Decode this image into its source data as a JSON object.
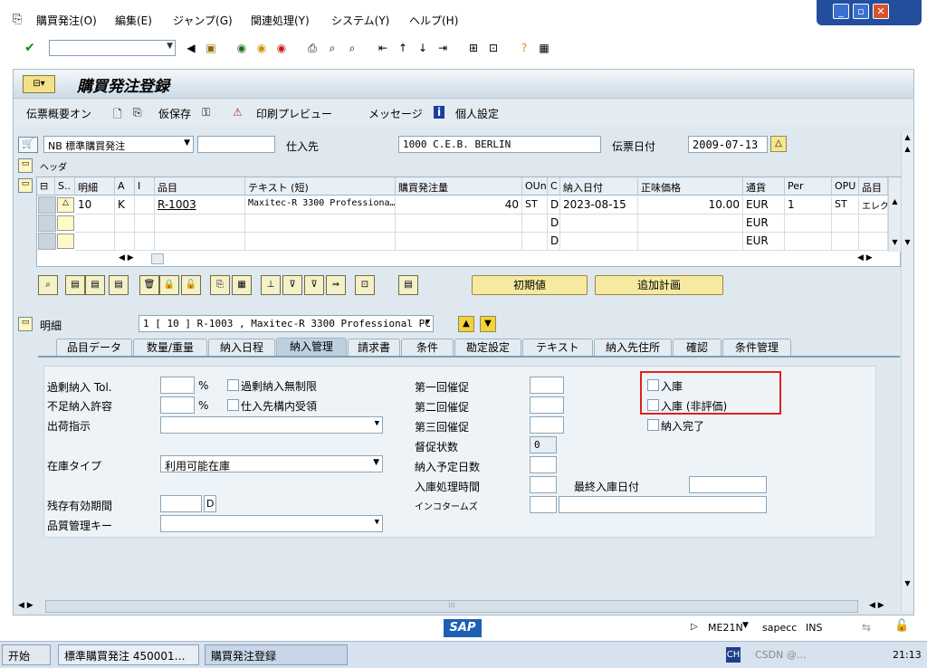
{
  "menu": {
    "items": [
      "購買発注(O)",
      "編集(E)",
      "ジャンプ(G)",
      "関連処理(Y)",
      "システム(Y)",
      "ヘルプ(H)"
    ]
  },
  "title": "購買発注登録",
  "app_toolbar": {
    "doc_overview": "伝票概要オン",
    "hold": "仮保存",
    "print_preview": "印刷プレビュー",
    "messages": "メッセージ",
    "personal": "個人設定"
  },
  "header": {
    "order_type_code": "NB",
    "order_type": "標準購買発注",
    "vendor_label": "仕入先",
    "vendor_value": "1000 C.E.B. BERLIN",
    "doc_date_label": "伝票日付",
    "doc_date": "2009-07-13",
    "header_label": "ヘッダ"
  },
  "grid": {
    "columns": [
      "S..",
      "明細",
      "A",
      "I",
      "品目",
      "テキスト (短)",
      "購買発注量",
      "OUn",
      "C",
      "納入日付",
      "正味価格",
      "通貨",
      "Per",
      "OPU",
      "品目"
    ],
    "rows": [
      {
        "item": "10",
        "a": "K",
        "material": "R-1003",
        "text": "Maxitec-R 3300 Professiona…",
        "qty": "40",
        "oun": "ST",
        "c": "D",
        "date": "2023-08-15",
        "price": "10.00",
        "curr": "EUR",
        "per": "1",
        "opu": "ST",
        "grp": "エレク"
      },
      {
        "item": "",
        "a": "",
        "material": "",
        "text": "",
        "qty": "",
        "oun": "",
        "c": "D",
        "date": "",
        "price": "",
        "curr": "EUR",
        "per": "",
        "opu": "",
        "grp": ""
      },
      {
        "item": "",
        "a": "",
        "material": "",
        "text": "",
        "qty": "",
        "oun": "",
        "c": "D",
        "date": "",
        "price": "",
        "curr": "EUR",
        "per": "",
        "opu": "",
        "grp": ""
      }
    ]
  },
  "buttons": {
    "default": "初期値",
    "add_plan": "追加計画"
  },
  "detail": {
    "label": "明細",
    "selected": "1 [ 10 ] R-1003 , Maxitec-R 3300 Professional PC"
  },
  "tabs": [
    "品目データ",
    "数量/重量",
    "納入日程",
    "納入管理",
    "請求書",
    "条件",
    "勘定設定",
    "テキスト",
    "納入先住所",
    "確認",
    "条件管理"
  ],
  "active_tab": "納入管理",
  "form": {
    "overdel_tol": "過剰納入 Tol.",
    "pct": "%",
    "unlimited_over": "過剰納入無制限",
    "underdel": "不足納入許容",
    "partial": "仕入先構内受領",
    "shipping": "出荷指示",
    "stock_type": "在庫タイプ",
    "stock_type_value": "利用可能在庫",
    "remaining_shelf": "残存有効期間",
    "shelf_unit": "D",
    "qm_key": "品質管理キー",
    "rem1": "第一回催促",
    "rem2": "第二回催促",
    "rem3": "第三回催促",
    "reminder_status": "督促状数",
    "reminder_status_value": "0",
    "plan_days": "納入予定日数",
    "gr_time": "入庫処理時間",
    "last_gr_date": "最終入庫日付",
    "incoterms": "インコタームズ",
    "gr": "入庫",
    "gr_nonval": "入庫 (非評価)",
    "delivery_complete": "納入完了"
  },
  "status": {
    "tcode": "ME21N",
    "system": "sapecc",
    "mode": "INS"
  },
  "taskbar": {
    "start": "开始",
    "task1": "標準購買発注 450001…",
    "task2": "購買発注登録",
    "lang": "CH",
    "time": "21:13",
    "watermark": "CSDN @..."
  }
}
